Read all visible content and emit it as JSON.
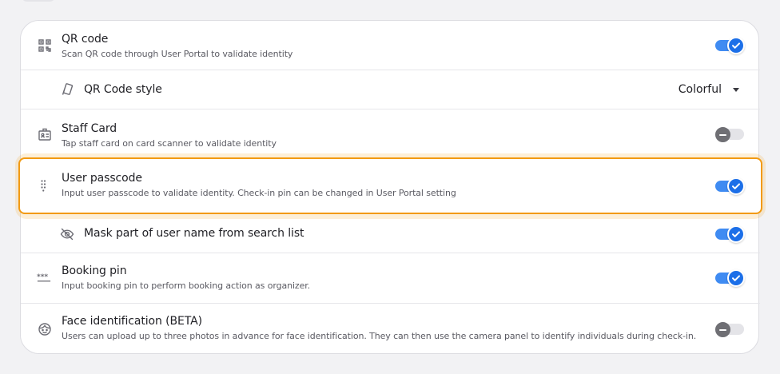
{
  "settings": {
    "qr_code": {
      "title": "QR code",
      "description": "Scan QR code through User Portal to validate identity",
      "icon": "qr-code-icon",
      "enabled": true
    },
    "qr_code_style": {
      "title": "QR Code style",
      "icon": "qr-style-icon",
      "selected": "Colorful"
    },
    "staff_card": {
      "title": "Staff Card",
      "description": "Tap staff card on card scanner to validate identity",
      "icon": "id-badge-icon",
      "enabled": false
    },
    "user_passcode": {
      "title": "User passcode",
      "description": "Input user passcode to validate identity. Check-in pin can be changed in User Portal setting",
      "icon": "keypad-icon",
      "enabled": true
    },
    "mask_user_name": {
      "title": "Mask part of user name from search list",
      "icon": "eye-off-icon",
      "enabled": true
    },
    "booking_pin": {
      "title": "Booking pin",
      "description": "Input booking pin to perform booking action as organizer.",
      "icon": "pin-dots-icon",
      "enabled": true
    },
    "face_identification": {
      "title": "Face identification (BETA)",
      "description": "Users can upload up to three photos in advance for face identification. They can then use the camera panel to identify individuals during check-in.",
      "icon": "face-icon",
      "enabled": false
    }
  },
  "colors": {
    "accent": "#1c6fe8",
    "highlight": "#f29a12",
    "toggle_off": "#6f6f74"
  }
}
